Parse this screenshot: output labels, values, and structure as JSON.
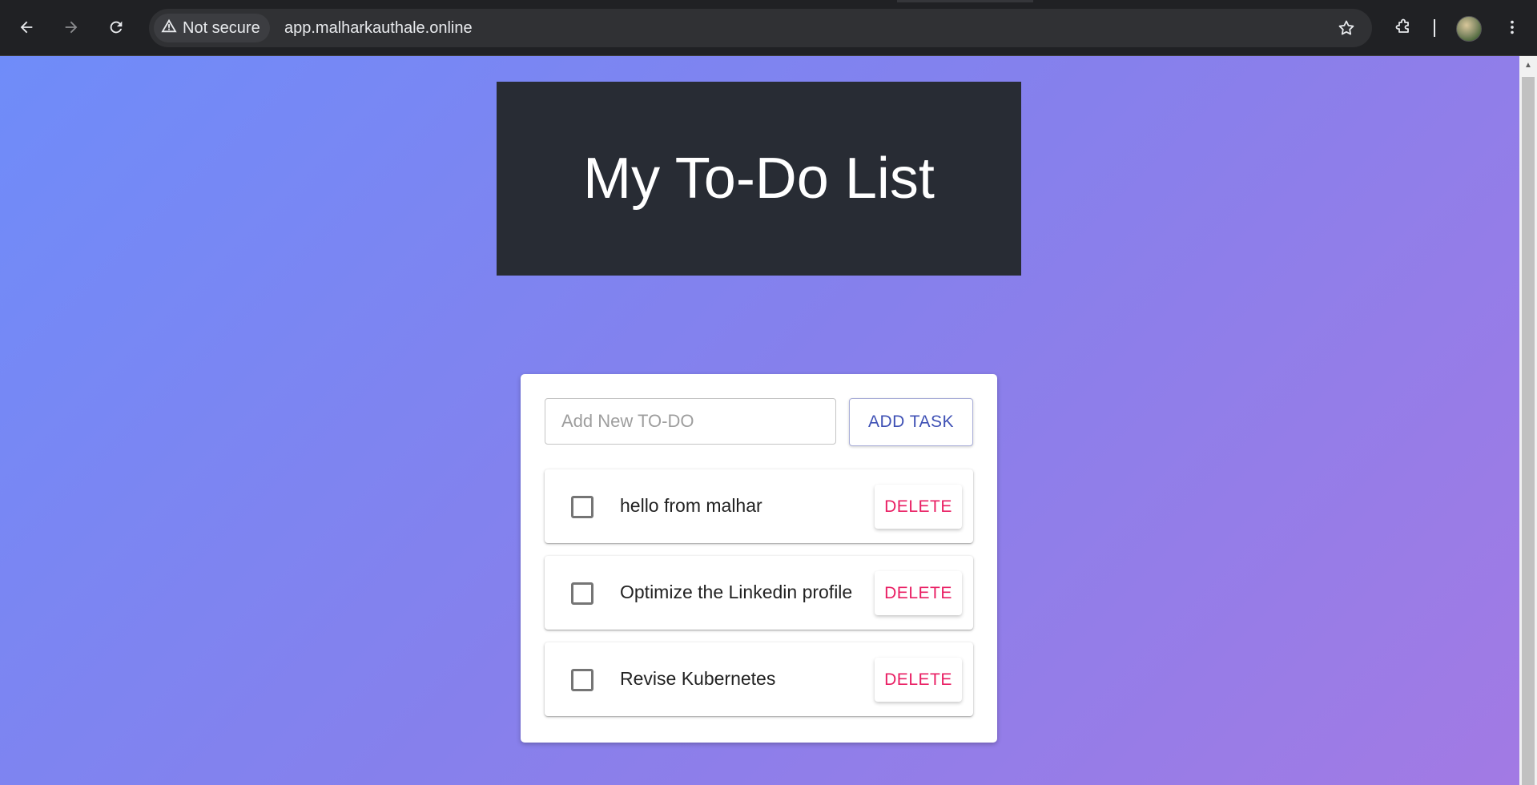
{
  "browser": {
    "security_label": "Not secure",
    "url": "app.malharkauthale.online",
    "icons": {
      "back": "back-arrow-icon",
      "forward": "forward-arrow-icon",
      "reload": "reload-icon",
      "warning": "warning-icon",
      "bookmark": "star-icon",
      "extensions": "puzzle-icon",
      "profile": "avatar",
      "menu": "kebab-menu-icon"
    }
  },
  "page": {
    "title": "My To-Do List",
    "input_placeholder": "Add New TO-DO",
    "input_value": "",
    "add_button_label": "ADD TASK",
    "todos": [
      {
        "text": "hello from malhar",
        "done": false,
        "delete_label": "DELETE"
      },
      {
        "text": "Optimize the Linkedin profile",
        "done": false,
        "delete_label": "DELETE"
      },
      {
        "text": "Revise Kubernetes",
        "done": false,
        "delete_label": "DELETE"
      }
    ]
  },
  "colors": {
    "header_bg": "#282c34",
    "gradient_start": "#6f8cf9",
    "gradient_end": "#a27ae4",
    "add_button_text": "#3f51b5",
    "delete_button_text": "#e91e63"
  }
}
